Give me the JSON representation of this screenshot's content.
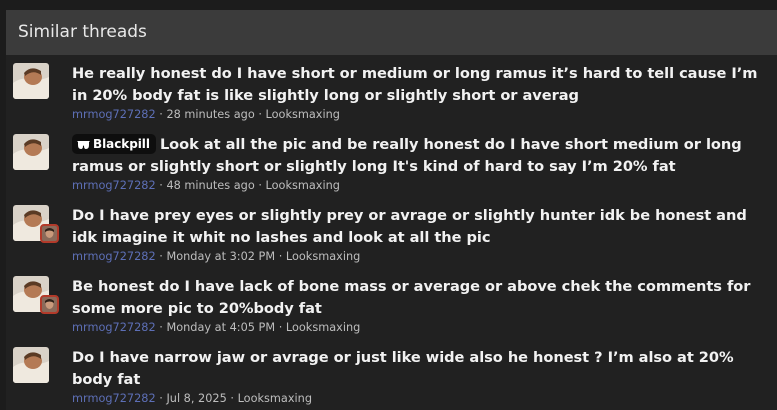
{
  "block": {
    "title": "Similar threads"
  },
  "threads": [
    {
      "prefix": "",
      "title": "He really honest do I have short or medium or long ramus it’s hard to tell cause I’m in 20% body fat is like slightly long or slightly short or averag",
      "author": "mrmog727282",
      "time": "28 minutes ago",
      "forum": "Looksmaxing"
    },
    {
      "prefix": "Blackpill",
      "title": "Look at all the pic and be really honest do I have short medium or long ramus or slightly short or slightly long It's kind of hard to say I’m 20% fat",
      "author": "mrmog727282",
      "time": "48 minutes ago",
      "forum": "Looksmaxing"
    },
    {
      "prefix": "",
      "title": "Do I have prey eyes or slightly prey or avrage or slightly hunter idk be honest and idk imagine it whit no lashes and look at all the pic",
      "author": "mrmog727282",
      "time": "Monday at 3:02 PM",
      "forum": "Looksmaxing"
    },
    {
      "prefix": "",
      "title": "Be honest do I have lack of bone mass or average or above chek the comments for some more pic to 20%body fat",
      "author": "mrmog727282",
      "time": "Monday at 4:05 PM",
      "forum": "Looksmaxing"
    },
    {
      "prefix": "",
      "title": "Do I have narrow jaw or avrage or just like wide also he honest ? I’m also at 20% body fat",
      "author": "mrmog727282",
      "time": "Jul 8, 2025",
      "forum": "Looksmaxing"
    }
  ],
  "separator": " · ",
  "icons": {
    "prefix_icon": "sunglasses-icon"
  },
  "colors": {
    "header_bg": "#3b3b3b",
    "author": "#5d6fb6",
    "prefix_bg": "#0e0e0e"
  }
}
